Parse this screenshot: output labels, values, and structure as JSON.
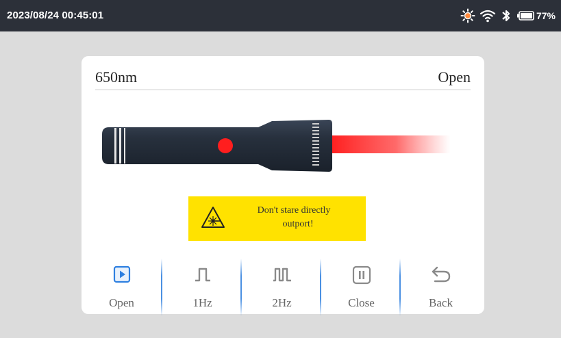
{
  "status_bar": {
    "datetime": "2023/08/24 00:45:01",
    "battery_percent": "77%",
    "icons": [
      "brightness-icon",
      "wifi-icon",
      "bluetooth-icon",
      "battery-icon"
    ]
  },
  "card": {
    "wavelength": "650nm",
    "state": "Open",
    "warning": {
      "line1": "Don't stare directly",
      "line2": "outport!"
    }
  },
  "toolbar": {
    "items": [
      {
        "label": "Open",
        "icon": "play-icon",
        "active": true
      },
      {
        "label": "1Hz",
        "icon": "pulse-1hz-icon",
        "active": false
      },
      {
        "label": "2Hz",
        "icon": "pulse-2hz-icon",
        "active": false
      },
      {
        "label": "Close",
        "icon": "pause-icon",
        "active": false
      },
      {
        "label": "Back",
        "icon": "back-arrow-icon",
        "active": false
      }
    ]
  },
  "colors": {
    "accent": "#2d7fe0",
    "laser": "#ff1e1e",
    "warning_bg": "#ffe200",
    "status_bar_bg": "#2c3039"
  }
}
